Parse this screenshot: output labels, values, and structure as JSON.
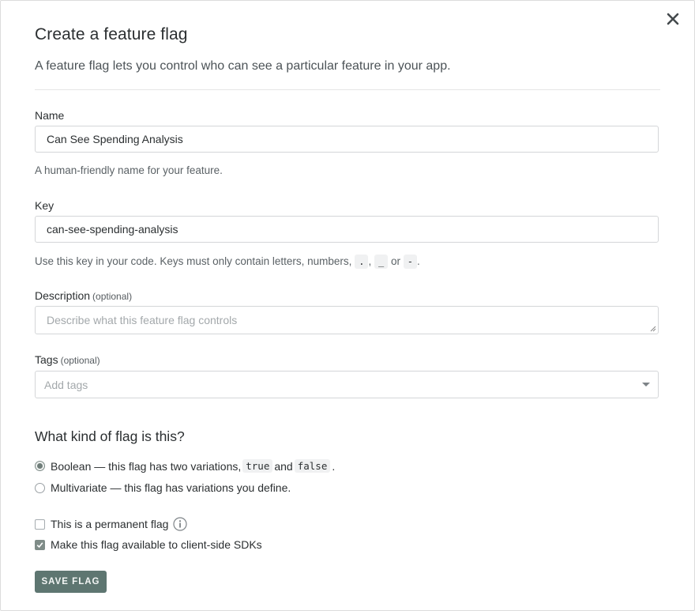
{
  "dialog": {
    "title": "Create a feature flag",
    "lead": "A feature flag lets you control who can see a particular feature in your app.",
    "close_icon": "close-icon"
  },
  "name": {
    "label": "Name",
    "value": "Can See Spending Analysis",
    "hint": "A human-friendly name for your feature."
  },
  "key": {
    "label": "Key",
    "value": "can-see-spending-analysis",
    "hint_prefix": "Use this key in your code. Keys must only contain letters, numbers,",
    "char_dot": ".",
    "sep1": ",",
    "char_underscore": "_",
    "sep2": "or",
    "char_dash": "-",
    "hint_suffix": "."
  },
  "description": {
    "label": "Description",
    "optional": "(optional)",
    "placeholder": "Describe what this feature flag controls"
  },
  "tags": {
    "label": "Tags",
    "optional": "(optional)",
    "placeholder": "Add tags"
  },
  "flag_kind": {
    "heading": "What kind of flag is this?",
    "boolean": {
      "label_prefix": "Boolean — this flag has two variations,",
      "val_true": "true",
      "and": "and",
      "val_false": "false",
      "suffix": ".",
      "selected": true
    },
    "multivariate": {
      "label": "Multivariate — this flag has variations you define.",
      "selected": false
    }
  },
  "options": {
    "permanent": {
      "label": "This is a permanent flag",
      "checked": false,
      "info_icon": "info-icon"
    },
    "client_side": {
      "label": "Make this flag available to client-side SDKs",
      "checked": true
    }
  },
  "actions": {
    "save_label": "SAVE FLAG"
  },
  "colors": {
    "accent": "#5e7671",
    "text": "#2b2f31",
    "border": "#d4d6d8"
  }
}
